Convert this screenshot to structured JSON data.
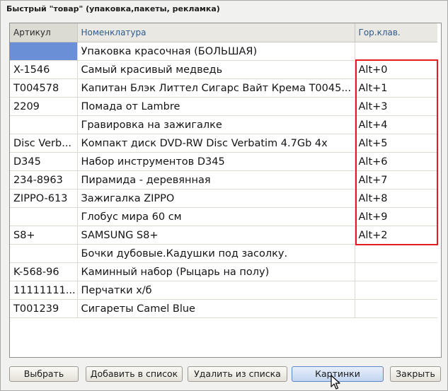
{
  "window": {
    "title": "Быстрый \"товар\" (упаковка,пакеты, рекламка)"
  },
  "table": {
    "columns": [
      "Артикул",
      "Номенклатура",
      "Гор.клав."
    ],
    "rows": [
      {
        "article": "",
        "name": "Упаковка красочная (БОЛЬШАЯ)",
        "hotkey": ""
      },
      {
        "article": "X-1546",
        "name": "Самый красивый медведь",
        "hotkey": "Alt+0"
      },
      {
        "article": "T004578",
        "name": "Капитан Блэк Литтел Сигарс Вайт Крема T0045...",
        "hotkey": "Alt+1"
      },
      {
        "article": "2209",
        "name": "Помада от Lambre",
        "hotkey": "Alt+3"
      },
      {
        "article": "",
        "name": "Гравировка на зажигалке",
        "hotkey": "Alt+4"
      },
      {
        "article": "Disc Verb...",
        "name": "Компакт диск DVD-RW Disc Verbatim 4.7Gb 4x",
        "hotkey": "Alt+5"
      },
      {
        "article": "D345",
        "name": "Набор инструментов D345",
        "hotkey": "Alt+6"
      },
      {
        "article": "234-8963",
        "name": "Пирамида - деревянная",
        "hotkey": "Alt+7"
      },
      {
        "article": "ZIPPO-613",
        "name": "Зажигалка ZIPPO",
        "hotkey": "Alt+8"
      },
      {
        "article": "",
        "name": "Глобус мира 60 см",
        "hotkey": "Alt+9"
      },
      {
        "article": "S8+",
        "name": "SAMSUNG S8+",
        "hotkey": "Alt+2"
      },
      {
        "article": "",
        "name": "Бочки дубовые.Кадушки под засолку.",
        "hotkey": ""
      },
      {
        "article": "K-568-96",
        "name": "Каминный набор (Рыцарь на полу)",
        "hotkey": ""
      },
      {
        "article": "11111111...",
        "name": "Перчатки х/б",
        "hotkey": ""
      },
      {
        "article": "T001239",
        "name": "Сигареты Camel Blue",
        "hotkey": ""
      }
    ],
    "selected_row": 0
  },
  "buttons": {
    "select": "Выбрать",
    "add_to_list": "Добавить в список",
    "remove_from_list": "Удалить из списка",
    "pictures": "Картинки",
    "close": "Закрыть"
  },
  "colors": {
    "selection": "#6b8fd6",
    "highlight_frame": "#e51a1a",
    "header_link": "#2d5b8e"
  },
  "icons": {
    "cursor": "mouse-pointer-icon"
  }
}
